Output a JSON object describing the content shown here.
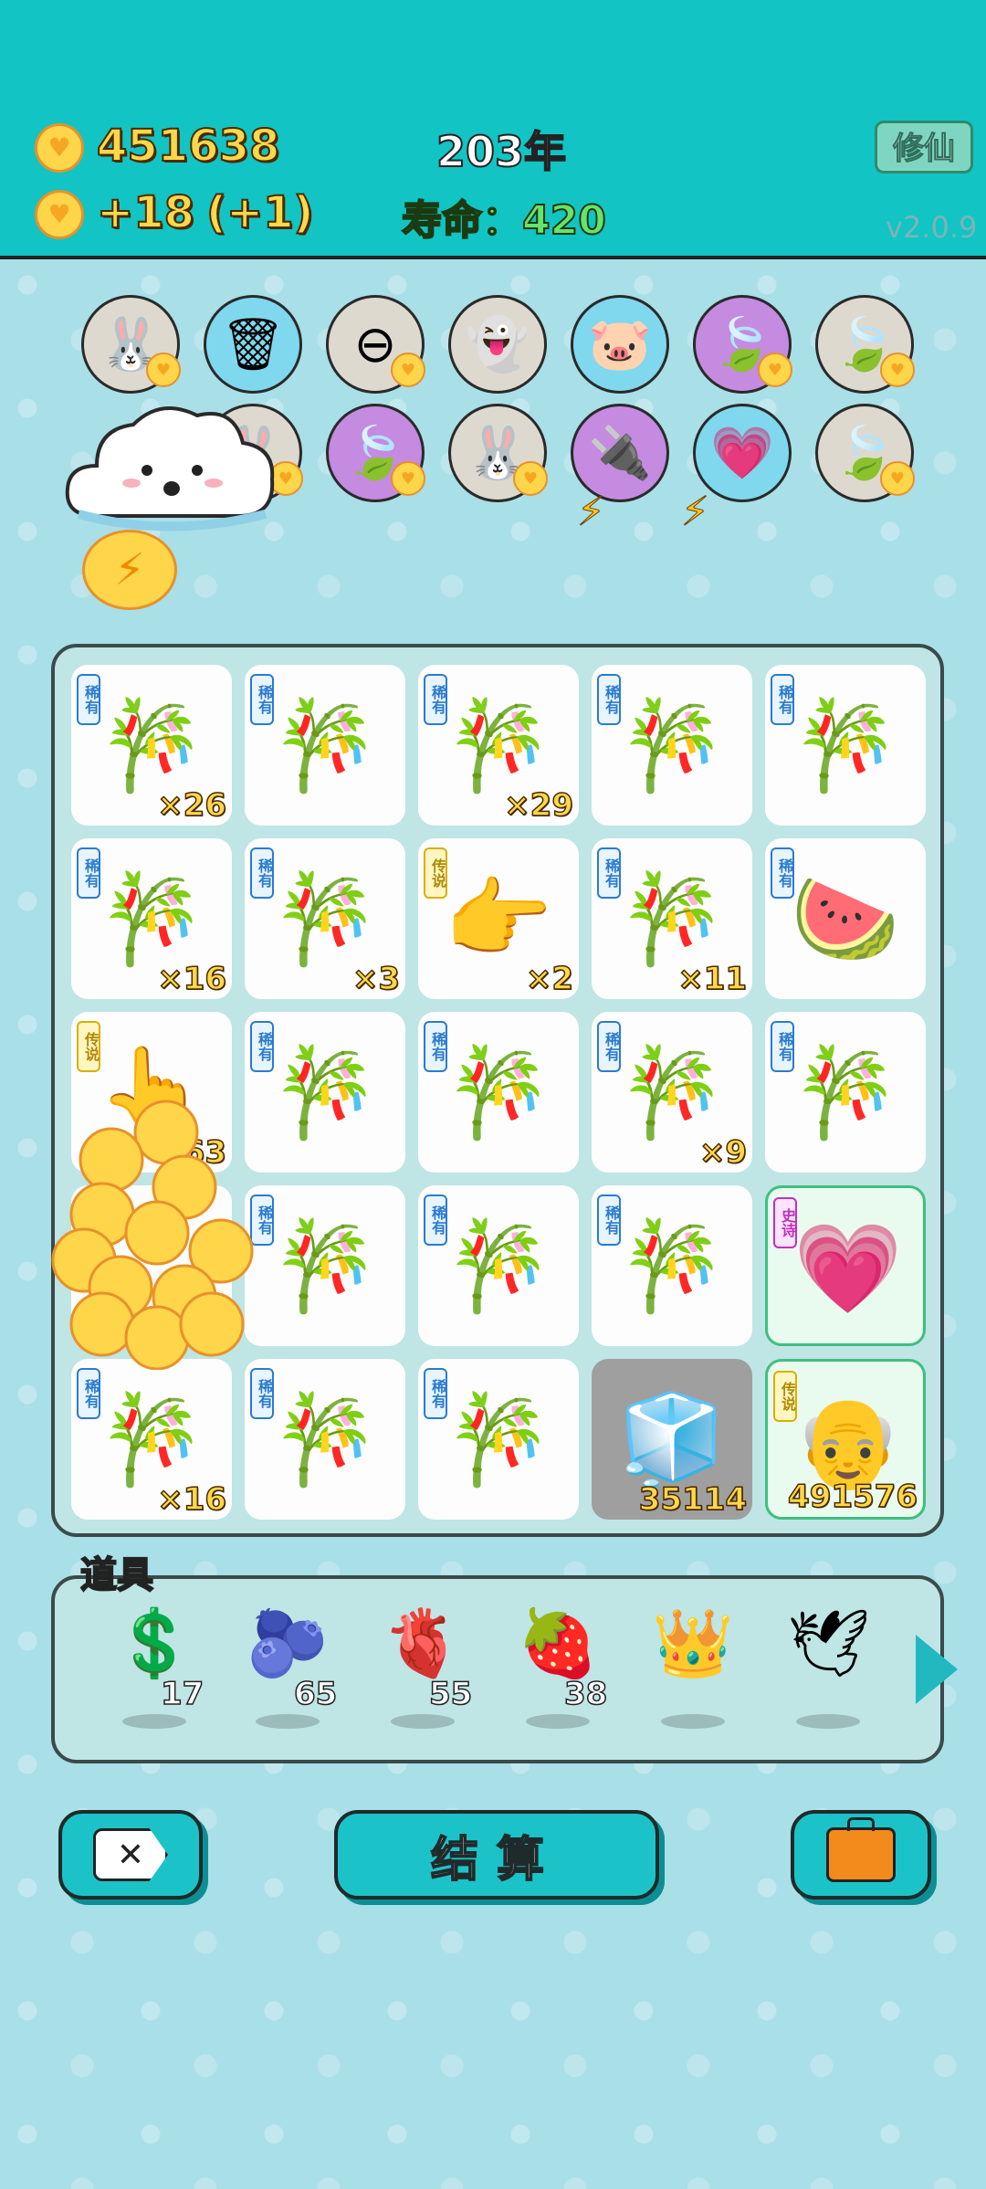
{
  "header": {
    "coins": "451638",
    "income": "+18",
    "income_bonus": "(+1)",
    "year": "203年",
    "life": "寿命：420",
    "cultivate_button": "修仙",
    "version": "v2.0.9"
  },
  "pets": [
    {
      "icon": "rabbit-icon",
      "glyph": "🐰",
      "style": "gray",
      "badge": true
    },
    {
      "icon": "recycle-bag-icon",
      "glyph": "🗑",
      "style": "blue",
      "badge": false
    },
    {
      "icon": "minus-sign-icon",
      "glyph": "⊖",
      "style": "gray",
      "badge": true
    },
    {
      "icon": "ghost-icon",
      "glyph": "👻",
      "style": "gray",
      "badge": false
    },
    {
      "icon": "piggy-bank-icon",
      "glyph": "🐷",
      "style": "blue",
      "badge": false
    },
    {
      "icon": "leaf-icon",
      "glyph": "🍃",
      "style": "purple",
      "badge": true
    },
    {
      "icon": "leaf-icon",
      "glyph": "🍃",
      "style": "gray",
      "badge": true
    },
    {
      "icon": "rabbit-icon",
      "glyph": "🐰",
      "style": "gray",
      "badge": true
    },
    {
      "icon": "leaf-icon",
      "glyph": "🍃",
      "style": "purple",
      "badge": true
    },
    {
      "icon": "rabbit-icon",
      "glyph": "🐰",
      "style": "gray",
      "badge": true
    },
    {
      "icon": "charger-icon",
      "glyph": "🔌",
      "style": "purple",
      "badge": false
    },
    {
      "icon": "heart-sign-icon",
      "glyph": "💗",
      "style": "blue",
      "badge": false
    },
    {
      "icon": "leaf-icon",
      "glyph": "🍃",
      "style": "gray",
      "badge": true
    }
  ],
  "board": [
    {
      "tag": "稀有",
      "tagType": "rare",
      "icon": "bamboo-icon",
      "glyph": "🎋",
      "count": "×26"
    },
    {
      "tag": "稀有",
      "tagType": "rare",
      "icon": "bamboo-icon",
      "glyph": "🎋",
      "count": ""
    },
    {
      "tag": "稀有",
      "tagType": "rare",
      "icon": "bamboo-icon",
      "glyph": "🎋",
      "count": "×29"
    },
    {
      "tag": "稀有",
      "tagType": "rare",
      "icon": "bamboo-icon",
      "glyph": "🎋",
      "count": ""
    },
    {
      "tag": "稀有",
      "tagType": "rare",
      "icon": "bamboo-icon",
      "glyph": "🎋",
      "count": ""
    },
    {
      "tag": "稀有",
      "tagType": "rare",
      "icon": "bamboo-icon",
      "glyph": "🎋",
      "count": "×16"
    },
    {
      "tag": "稀有",
      "tagType": "rare",
      "icon": "bamboo-icon",
      "glyph": "🎋",
      "count": "×3"
    },
    {
      "tag": "传说",
      "tagType": "legend",
      "icon": "pointing-hand-icon",
      "glyph": "👉",
      "count": "×2"
    },
    {
      "tag": "稀有",
      "tagType": "rare",
      "icon": "bamboo-icon",
      "glyph": "🎋",
      "count": "×11"
    },
    {
      "tag": "稀有",
      "tagType": "rare",
      "icon": "watermelon-icon",
      "glyph": "🍉",
      "count": ""
    },
    {
      "tag": "传说",
      "tagType": "legend",
      "icon": "pointing-hand-icon",
      "glyph": "👆",
      "count": "63"
    },
    {
      "tag": "稀有",
      "tagType": "rare",
      "icon": "bamboo-icon",
      "glyph": "🎋",
      "count": ""
    },
    {
      "tag": "稀有",
      "tagType": "rare",
      "icon": "bamboo-icon",
      "glyph": "🎋",
      "count": ""
    },
    {
      "tag": "稀有",
      "tagType": "rare",
      "icon": "bamboo-icon",
      "glyph": "🎋",
      "count": "×9"
    },
    {
      "tag": "稀有",
      "tagType": "rare",
      "icon": "bamboo-icon",
      "glyph": "🎋",
      "count": ""
    },
    {
      "tag": "",
      "tagType": "rare",
      "icon": "coin-stack-icon",
      "glyph": "",
      "count": ""
    },
    {
      "tag": "稀有",
      "tagType": "rare",
      "icon": "bamboo-icon",
      "glyph": "🎋",
      "count": ""
    },
    {
      "tag": "稀有",
      "tagType": "rare",
      "icon": "bamboo-icon",
      "glyph": "🎋",
      "count": ""
    },
    {
      "tag": "稀有",
      "tagType": "rare",
      "icon": "bamboo-icon",
      "glyph": "🎋",
      "count": ""
    },
    {
      "tag": "史诗",
      "tagType": "epic",
      "icon": "heart-face-icon",
      "glyph": "💗",
      "count": ""
    },
    {
      "tag": "稀有",
      "tagType": "rare",
      "icon": "bamboo-icon",
      "glyph": "🎋",
      "count": "×16"
    },
    {
      "tag": "稀有",
      "tagType": "rare",
      "icon": "bamboo-icon",
      "glyph": "🎋",
      "count": ""
    },
    {
      "tag": "稀有",
      "tagType": "rare",
      "icon": "bamboo-icon",
      "glyph": "🎋",
      "count": ""
    },
    {
      "tag": "",
      "tagType": "none",
      "icon": "fridge-icon",
      "glyph": "🧊",
      "count": "35114"
    },
    {
      "tag": "传说",
      "tagType": "legend",
      "icon": "old-man-icon",
      "glyph": "👴",
      "count": "491576"
    }
  ],
  "tools": {
    "label": "道具",
    "items": [
      {
        "icon": "dollar-coin-icon",
        "glyph": "💲",
        "qty": "17"
      },
      {
        "icon": "blueberry-icon",
        "glyph": "🫐",
        "qty": "65"
      },
      {
        "icon": "liver-icon",
        "glyph": "🫀",
        "qty": "55"
      },
      {
        "icon": "strawberry-icon",
        "glyph": "🍓",
        "qty": "38"
      },
      {
        "icon": "crown-icon",
        "glyph": "👑",
        "qty": ""
      },
      {
        "icon": "bird-icon",
        "glyph": "🕊",
        "qty": ""
      }
    ]
  },
  "buttons": {
    "settle": "结算"
  }
}
